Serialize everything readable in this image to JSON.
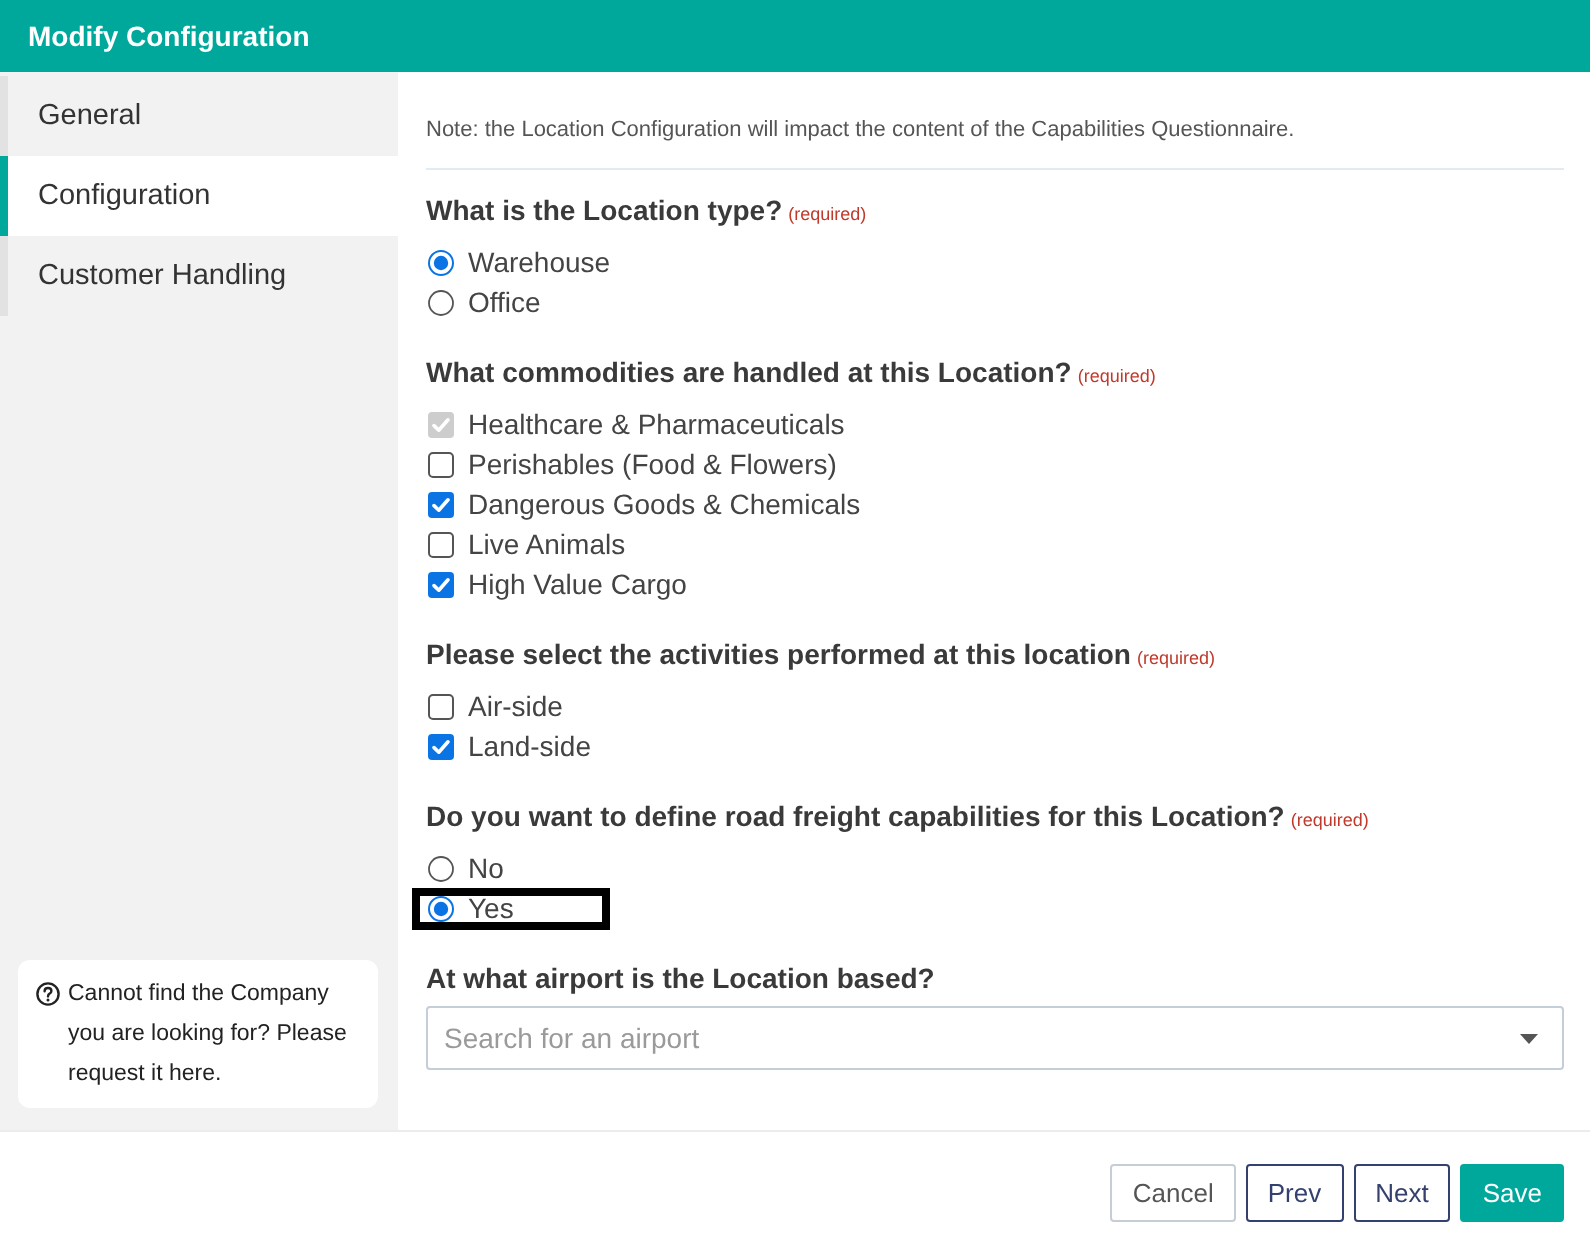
{
  "window": {
    "title": "Modify Configuration"
  },
  "sidebar": {
    "items": [
      {
        "label": "General",
        "selected": false
      },
      {
        "label": "Configuration",
        "selected": true
      },
      {
        "label": "Customer Handling",
        "selected": false
      }
    ],
    "help": {
      "text": "Cannot find the Company you are looking for? Please request it here."
    }
  },
  "note": "Note: the Location Configuration will impact the content of the Capabilities Questionnaire.",
  "questions": [
    {
      "kind": "radio",
      "label": "What is the Location type?",
      "required_note": "(required)",
      "options": [
        {
          "label": "Warehouse",
          "selected": true
        },
        {
          "label": "Office",
          "selected": false
        }
      ]
    },
    {
      "kind": "checkbox",
      "label": "What commodities are handled at this Location?",
      "required_note": "(required)",
      "options": [
        {
          "label": "Healthcare & Pharmaceuticals",
          "checked": true,
          "disabled": true
        },
        {
          "label": "Perishables (Food & Flowers)",
          "checked": false,
          "disabled": false
        },
        {
          "label": "Dangerous Goods & Chemicals",
          "checked": true,
          "disabled": false
        },
        {
          "label": "Live Animals",
          "checked": false,
          "disabled": false
        },
        {
          "label": "High Value Cargo",
          "checked": true,
          "disabled": false
        }
      ]
    },
    {
      "kind": "checkbox",
      "label": "Please select the activities performed at this location",
      "required_note": "(required)",
      "options": [
        {
          "label": "Air-side",
          "checked": false,
          "disabled": false
        },
        {
          "label": "Land-side",
          "checked": true,
          "disabled": false
        }
      ]
    },
    {
      "kind": "radio",
      "label": "Do you want to define road freight capabilities for this Location?",
      "required_note": "(required)",
      "options": [
        {
          "label": "No",
          "selected": false,
          "highlighted": false
        },
        {
          "label": "Yes",
          "selected": true,
          "highlighted": true
        }
      ]
    },
    {
      "kind": "select",
      "label": "At what airport is the Location based?",
      "placeholder": "Search for an airport"
    }
  ],
  "buttons": [
    {
      "label": "Cancel",
      "kind": "secondary"
    },
    {
      "label": "Prev",
      "kind": "outline"
    },
    {
      "label": "Next",
      "kind": "outline"
    },
    {
      "label": "Save",
      "kind": "primary"
    }
  ]
}
